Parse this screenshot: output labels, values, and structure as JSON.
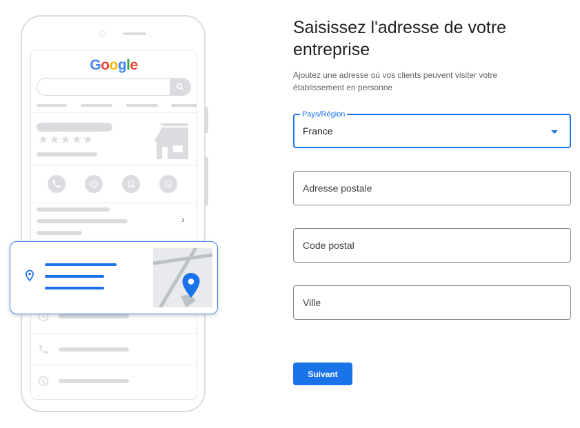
{
  "illustration": {
    "logo_letters": [
      {
        "char": "G",
        "color": "#4285f4"
      },
      {
        "char": "o",
        "color": "#ea4335"
      },
      {
        "char": "o",
        "color": "#fbbc05"
      },
      {
        "char": "g",
        "color": "#4285f4"
      },
      {
        "char": "l",
        "color": "#34a853"
      },
      {
        "char": "e",
        "color": "#ea4335"
      }
    ],
    "rating_stars": "★★★★★",
    "chevron": "›",
    "icons": [
      "search-icon",
      "phone-icon",
      "directions-icon",
      "bookmark-icon",
      "globe-icon",
      "storefront-icon",
      "location-pin-icon",
      "map-icon",
      "clock-icon"
    ]
  },
  "form": {
    "title": "Saisissez l'adresse de votre entreprise",
    "subtitle": "Ajoutez une adresse où vos clients peuvent visiter votre établissement en personne",
    "country_label": "Pays/Région",
    "country_value": "France",
    "street_placeholder": "Adresse postale",
    "postal_placeholder": "Code postal",
    "city_placeholder": "Ville",
    "next_button": "Suivant"
  },
  "colors": {
    "accent": "#1a73e8",
    "placeholder_grey": "#dadce0"
  }
}
